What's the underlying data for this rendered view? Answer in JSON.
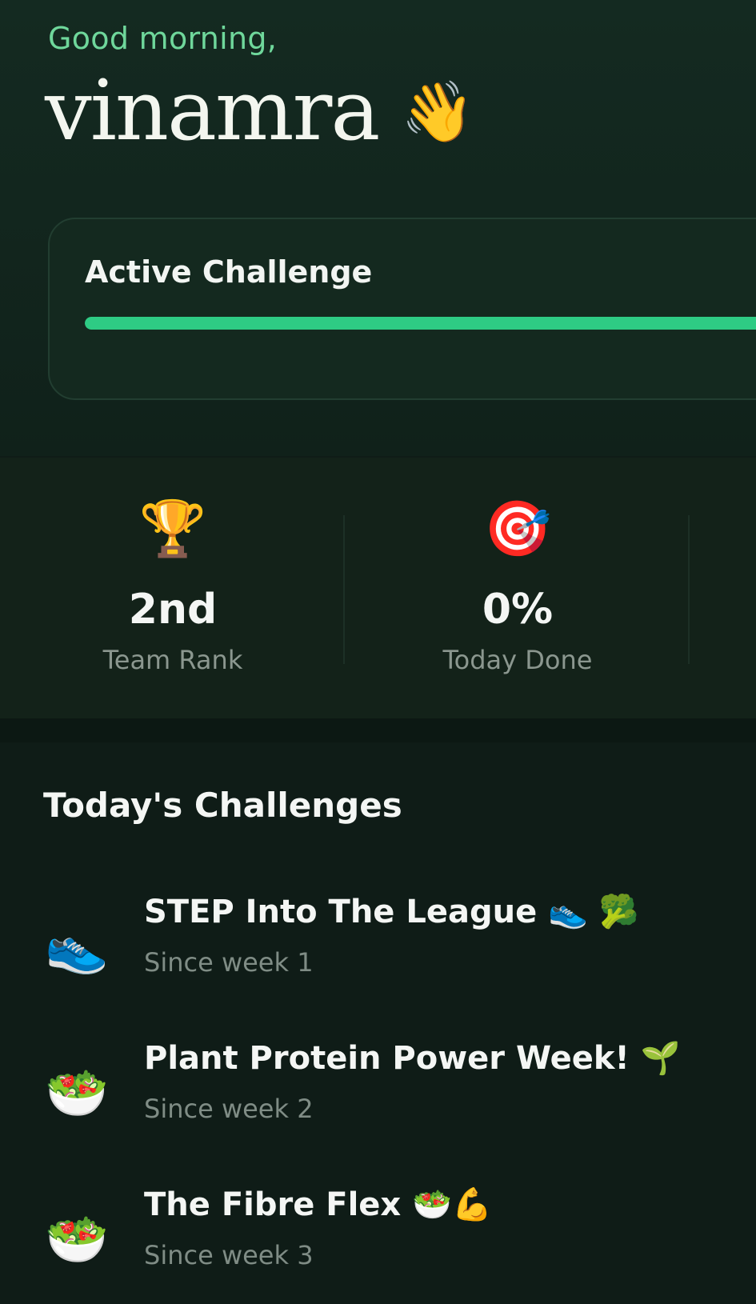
{
  "header": {
    "greeting": "Good morning,",
    "username": "vinamra",
    "wave_emoji": "👋"
  },
  "active_challenge": {
    "title": "Active Challenge",
    "progress_percent": 100,
    "accent_color": "#2ecb84"
  },
  "stats": [
    {
      "emoji": "🏆",
      "icon": "trophy-icon",
      "value": "2nd",
      "label": "Team Rank"
    },
    {
      "emoji": "🎯",
      "icon": "target-icon",
      "value": "0%",
      "label": "Today Done"
    }
  ],
  "challenges_section": {
    "title": "Today's Challenges",
    "items": [
      {
        "emoji": "👟",
        "icon": "sneaker-icon",
        "title": "STEP Into The League 👟 🥦",
        "subtitle": "Since week 1"
      },
      {
        "emoji": "🥗",
        "icon": "salad-icon",
        "title": "Plant Protein Power Week! 🌱",
        "subtitle": "Since week 2"
      },
      {
        "emoji": "🥗",
        "icon": "salad-icon",
        "title": "The Fibre Flex  🥗💪",
        "subtitle": "Since week 3"
      }
    ]
  }
}
